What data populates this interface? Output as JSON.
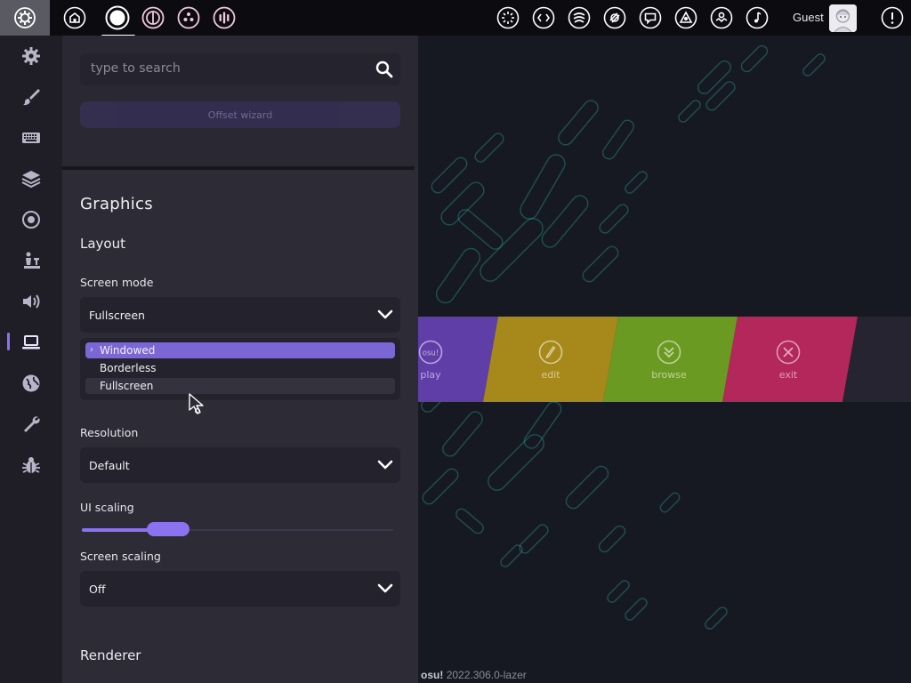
{
  "topbar": {
    "user_name": "Guest"
  },
  "search": {
    "placeholder": "type to search"
  },
  "panel": {
    "offset_wizard_label": "Offset wizard",
    "section_title": "Graphics",
    "layout_title": "Layout",
    "screen_mode": {
      "label": "Screen mode",
      "value": "Fullscreen",
      "options": [
        "Windowed",
        "Borderless",
        "Fullscreen"
      ],
      "highlighted": "Windowed"
    },
    "resolution": {
      "label": "Resolution",
      "value": "Default"
    },
    "ui_scaling": {
      "label": "UI scaling",
      "fraction": 0.27
    },
    "screen_scaling": {
      "label": "Screen scaling",
      "value": "Off"
    },
    "renderer_title": "Renderer"
  },
  "main_menu": {
    "buttons": [
      {
        "label": "play",
        "icon": "osu-icon",
        "color": "#5f3ea8"
      },
      {
        "label": "edit",
        "icon": "edit-icon",
        "color": "#a6891a"
      },
      {
        "label": "browse",
        "icon": "browse-icon",
        "color": "#6b9a23"
      },
      {
        "label": "exit",
        "icon": "exit-icon",
        "color": "#b3275a"
      }
    ],
    "play_logo_text": "osu!"
  },
  "version": {
    "brand": "osu!",
    "build": "2022.306.0-lazer"
  },
  "colors": {
    "accent": "#8a72f0",
    "panel_bg": "#2d2b36",
    "sidebar_bg": "#1f1e27",
    "bg_pattern": "#2bb6a8"
  }
}
